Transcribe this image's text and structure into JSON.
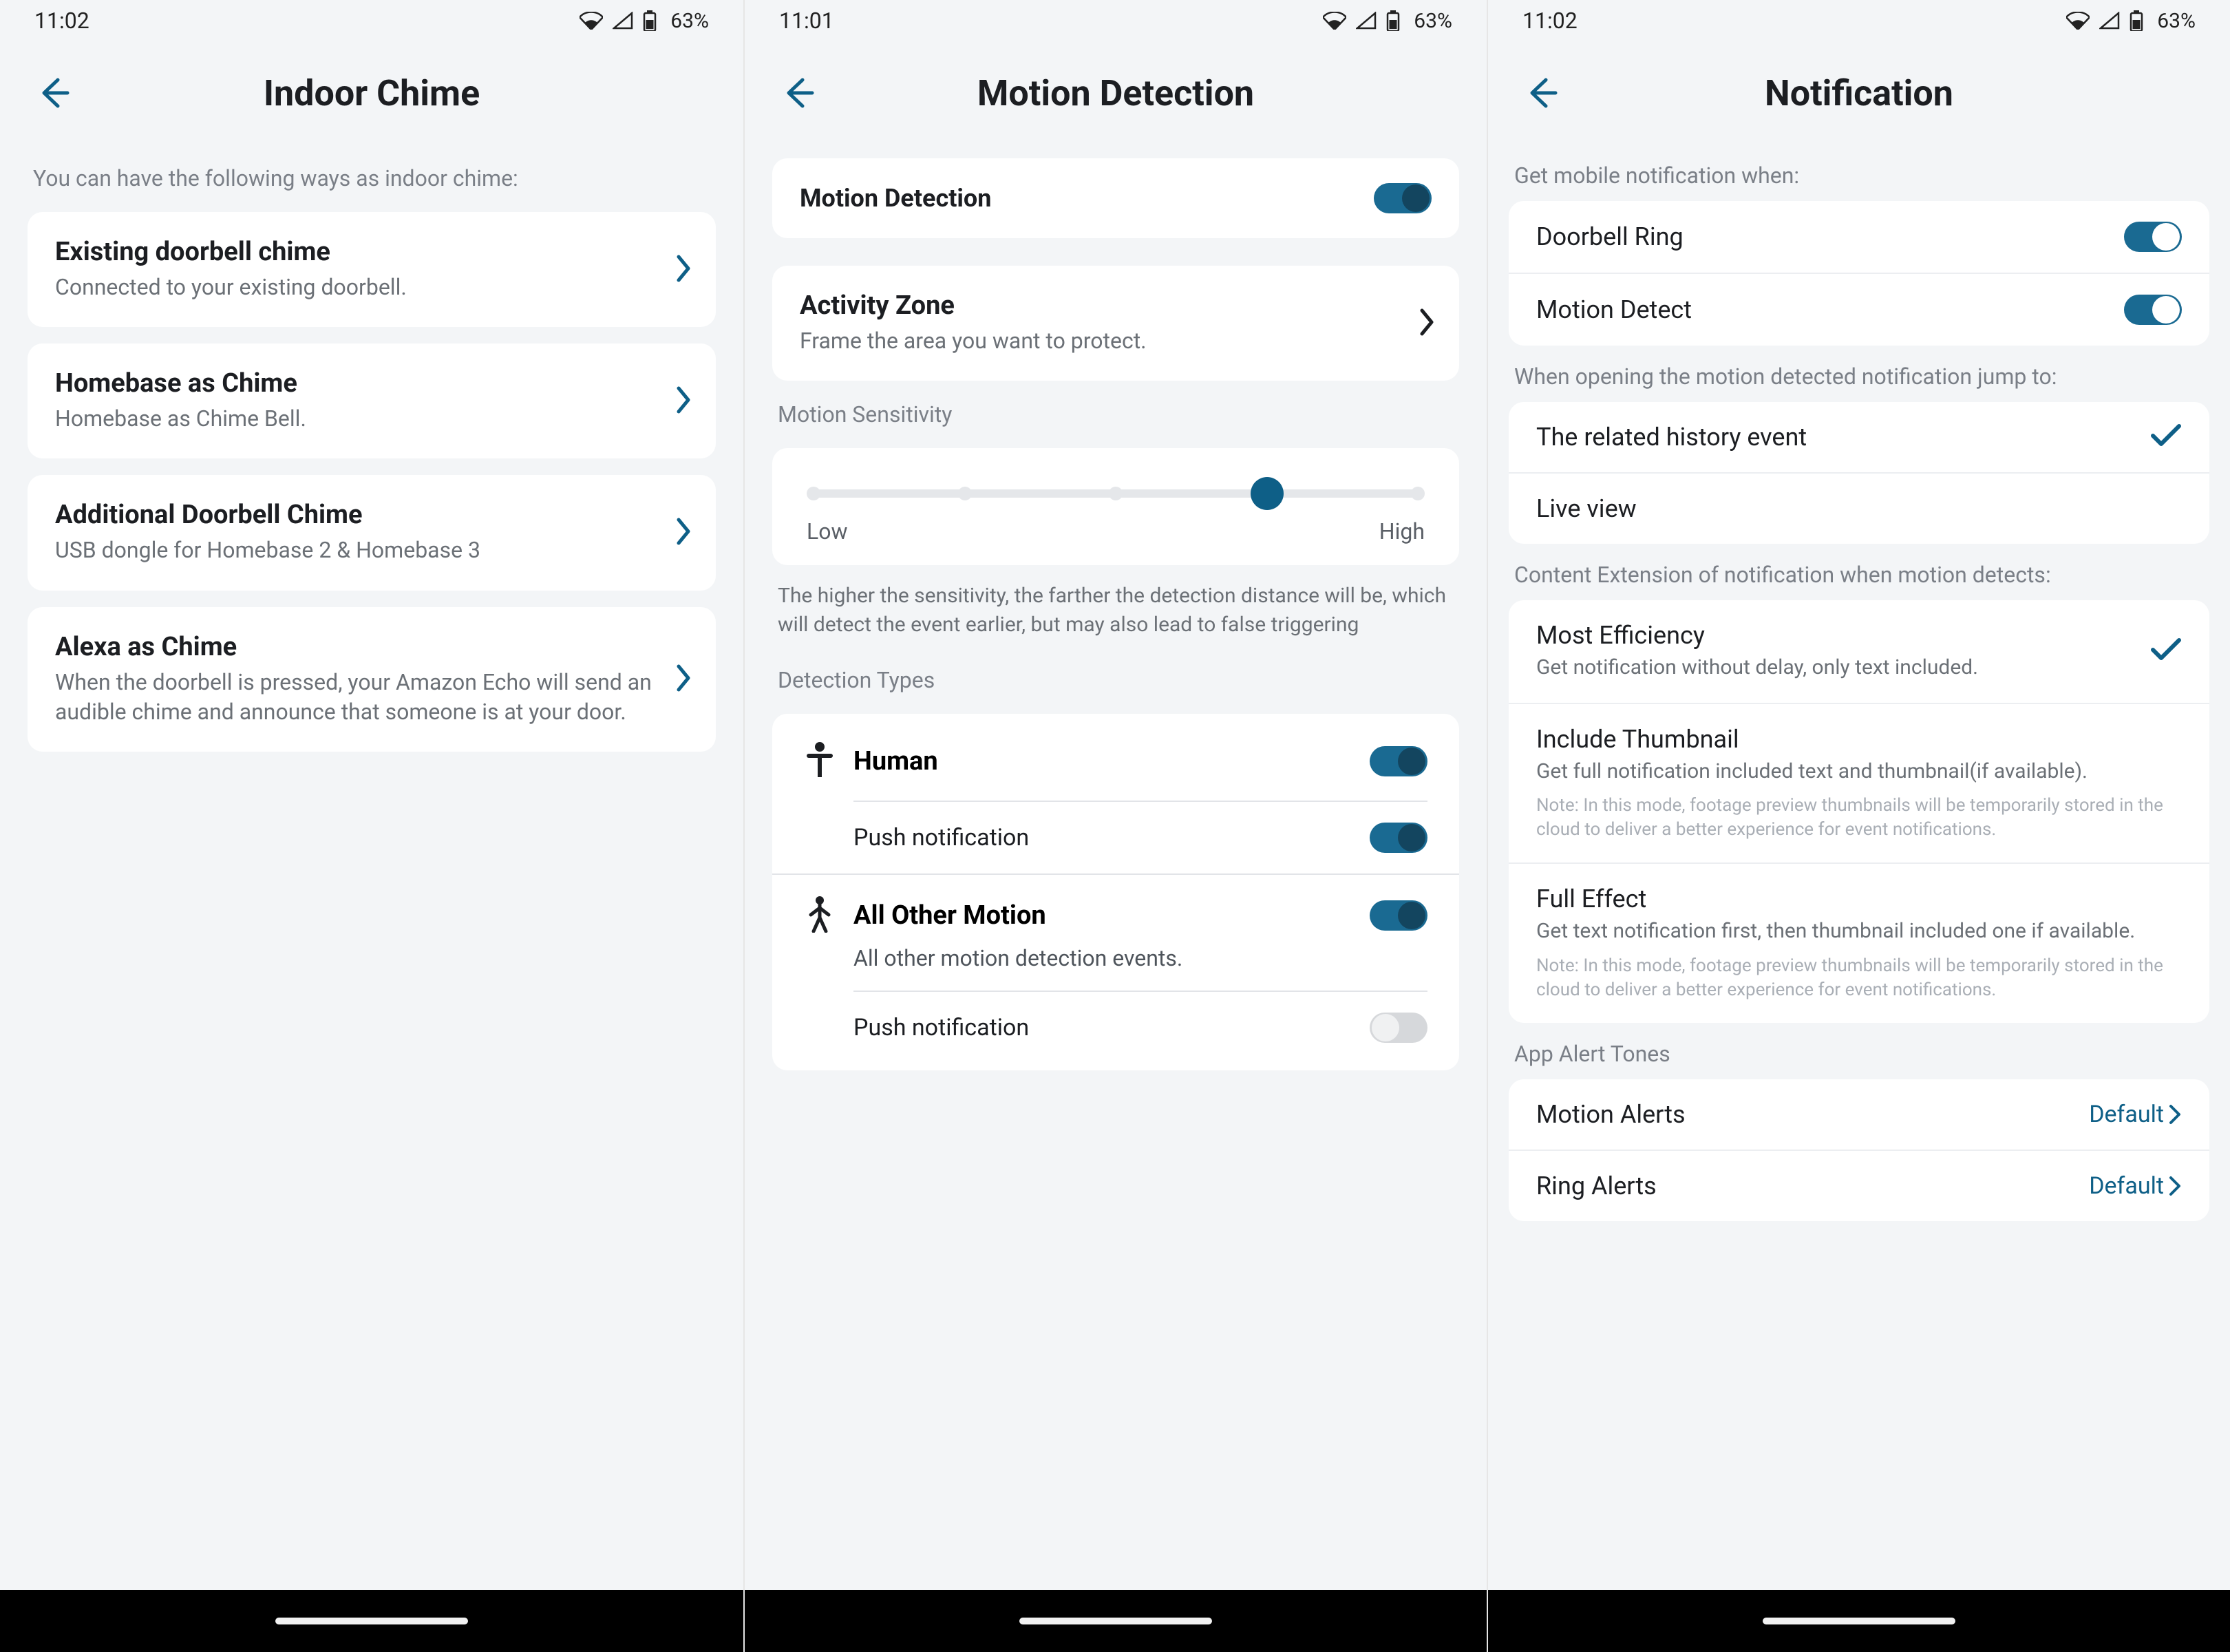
{
  "status": {
    "battery_pct": "63%"
  },
  "screens": [
    {
      "time": "11:02",
      "title": "Indoor Chime",
      "intro": "You can have the following ways as indoor chime:",
      "items": [
        {
          "title": "Existing doorbell chime",
          "sub": "Connected to your existing doorbell."
        },
        {
          "title": "Homebase as Chime",
          "sub": "Homebase as Chime Bell."
        },
        {
          "title": "Additional Doorbell Chime",
          "sub": "USB dongle for Homebase 2 & Homebase 3"
        },
        {
          "title": "Alexa as Chime",
          "sub": "When the doorbell is pressed, your Amazon Echo will send an audible chime and announce that someone is at your door."
        }
      ]
    },
    {
      "time": "11:01",
      "title": "Motion Detection",
      "motion_toggle": {
        "label": "Motion Detection",
        "on": true
      },
      "activity_zone": {
        "title": "Activity Zone",
        "sub": "Frame the area you want to protect."
      },
      "sensitivity": {
        "label": "Motion Sensitivity",
        "low": "Low",
        "high": "High",
        "value_index": 3,
        "steps": 5,
        "desc": "The higher the sensitivity, the farther the detection distance will be, which will detect the event earlier, but may also lead to false triggering"
      },
      "detection_types": {
        "label": "Detection Types",
        "human": {
          "name": "Human",
          "on": true,
          "push_label": "Push notification",
          "push_on": true
        },
        "all_other": {
          "name": "All Other Motion",
          "sub": "All other motion detection events.",
          "on": true,
          "push_label": "Push notification",
          "push_on": false
        }
      }
    },
    {
      "time": "11:02",
      "title": "Notification",
      "sec1": {
        "label": "Get mobile notification when:",
        "doorbell": {
          "label": "Doorbell Ring",
          "on": true
        },
        "motion": {
          "label": "Motion Detect",
          "on": true
        }
      },
      "sec2": {
        "label": "When opening the motion detected notification jump to:",
        "opt1": "The related history event",
        "opt2": "Live view",
        "selected": 0
      },
      "sec3": {
        "label": "Content Extension of notification when motion detects:",
        "opts": [
          {
            "title": "Most Efficiency",
            "sub": "Get notification without delay, only text included."
          },
          {
            "title": "Include Thumbnail",
            "sub": "Get full notification included text and thumbnail(if available).",
            "note": "Note: In this mode, footage preview thumbnails will be temporarily stored in the cloud to deliver a better experience for event notifications."
          },
          {
            "title": "Full Effect",
            "sub": "Get text notification first, then thumbnail included one if available.",
            "note": "Note: In this mode, footage preview thumbnails will be temporarily stored in the cloud to deliver a better experience for event notifications."
          }
        ],
        "selected": 0
      },
      "sec4": {
        "label": "App Alert Tones",
        "motion": {
          "label": "Motion Alerts",
          "value": "Default"
        },
        "ring": {
          "label": "Ring Alerts",
          "value": "Default"
        }
      }
    }
  ]
}
